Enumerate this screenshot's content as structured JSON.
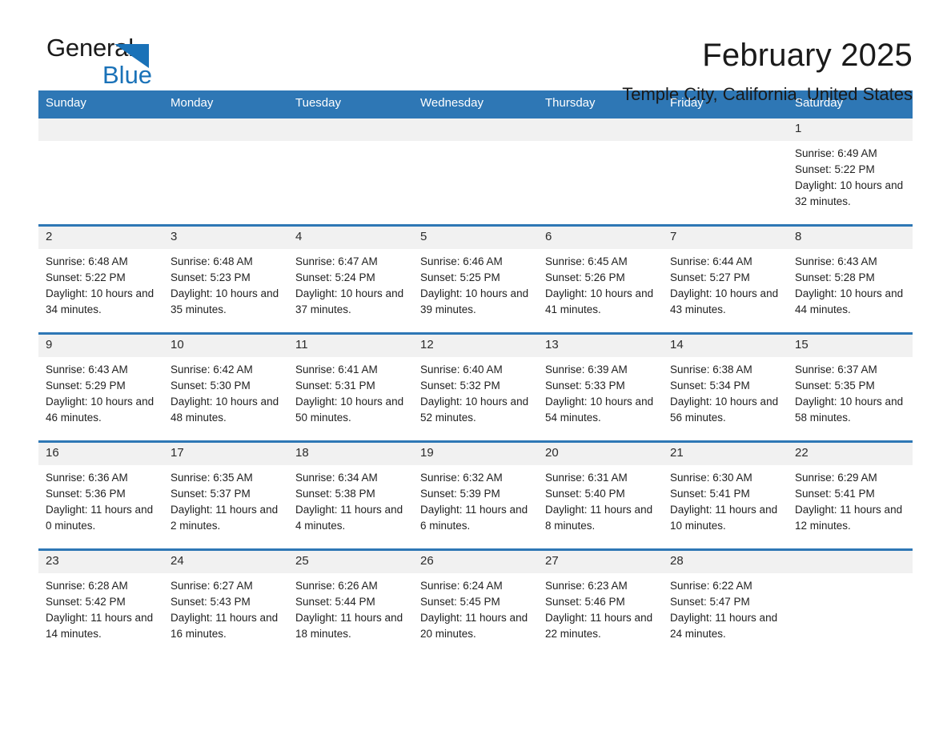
{
  "brand": {
    "name_part1": "General",
    "name_part2": "Blue",
    "accent_color": "#1a72b8"
  },
  "header": {
    "month_title": "February 2025",
    "location": "Temple City, California, United States"
  },
  "theme": {
    "header_blue": "#2e77b5",
    "daynum_bg": "#f1f1f1",
    "text": "#1f1f1f"
  },
  "weekday_headers": [
    "Sunday",
    "Monday",
    "Tuesday",
    "Wednesday",
    "Thursday",
    "Friday",
    "Saturday"
  ],
  "labels": {
    "sunrise_prefix": "Sunrise:",
    "sunset_prefix": "Sunset:",
    "daylight_prefix": "Daylight:"
  },
  "weeks": [
    [
      {
        "blank": true
      },
      {
        "blank": true
      },
      {
        "blank": true
      },
      {
        "blank": true
      },
      {
        "blank": true
      },
      {
        "blank": true
      },
      {
        "day": "1",
        "sunrise": "Sunrise: 6:49 AM",
        "sunset": "Sunset: 5:22 PM",
        "daylight": "Daylight: 10 hours and 32 minutes."
      }
    ],
    [
      {
        "day": "2",
        "sunrise": "Sunrise: 6:48 AM",
        "sunset": "Sunset: 5:22 PM",
        "daylight": "Daylight: 10 hours and 34 minutes."
      },
      {
        "day": "3",
        "sunrise": "Sunrise: 6:48 AM",
        "sunset": "Sunset: 5:23 PM",
        "daylight": "Daylight: 10 hours and 35 minutes."
      },
      {
        "day": "4",
        "sunrise": "Sunrise: 6:47 AM",
        "sunset": "Sunset: 5:24 PM",
        "daylight": "Daylight: 10 hours and 37 minutes."
      },
      {
        "day": "5",
        "sunrise": "Sunrise: 6:46 AM",
        "sunset": "Sunset: 5:25 PM",
        "daylight": "Daylight: 10 hours and 39 minutes."
      },
      {
        "day": "6",
        "sunrise": "Sunrise: 6:45 AM",
        "sunset": "Sunset: 5:26 PM",
        "daylight": "Daylight: 10 hours and 41 minutes."
      },
      {
        "day": "7",
        "sunrise": "Sunrise: 6:44 AM",
        "sunset": "Sunset: 5:27 PM",
        "daylight": "Daylight: 10 hours and 43 minutes."
      },
      {
        "day": "8",
        "sunrise": "Sunrise: 6:43 AM",
        "sunset": "Sunset: 5:28 PM",
        "daylight": "Daylight: 10 hours and 44 minutes."
      }
    ],
    [
      {
        "day": "9",
        "sunrise": "Sunrise: 6:43 AM",
        "sunset": "Sunset: 5:29 PM",
        "daylight": "Daylight: 10 hours and 46 minutes."
      },
      {
        "day": "10",
        "sunrise": "Sunrise: 6:42 AM",
        "sunset": "Sunset: 5:30 PM",
        "daylight": "Daylight: 10 hours and 48 minutes."
      },
      {
        "day": "11",
        "sunrise": "Sunrise: 6:41 AM",
        "sunset": "Sunset: 5:31 PM",
        "daylight": "Daylight: 10 hours and 50 minutes."
      },
      {
        "day": "12",
        "sunrise": "Sunrise: 6:40 AM",
        "sunset": "Sunset: 5:32 PM",
        "daylight": "Daylight: 10 hours and 52 minutes."
      },
      {
        "day": "13",
        "sunrise": "Sunrise: 6:39 AM",
        "sunset": "Sunset: 5:33 PM",
        "daylight": "Daylight: 10 hours and 54 minutes."
      },
      {
        "day": "14",
        "sunrise": "Sunrise: 6:38 AM",
        "sunset": "Sunset: 5:34 PM",
        "daylight": "Daylight: 10 hours and 56 minutes."
      },
      {
        "day": "15",
        "sunrise": "Sunrise: 6:37 AM",
        "sunset": "Sunset: 5:35 PM",
        "daylight": "Daylight: 10 hours and 58 minutes."
      }
    ],
    [
      {
        "day": "16",
        "sunrise": "Sunrise: 6:36 AM",
        "sunset": "Sunset: 5:36 PM",
        "daylight": "Daylight: 11 hours and 0 minutes."
      },
      {
        "day": "17",
        "sunrise": "Sunrise: 6:35 AM",
        "sunset": "Sunset: 5:37 PM",
        "daylight": "Daylight: 11 hours and 2 minutes."
      },
      {
        "day": "18",
        "sunrise": "Sunrise: 6:34 AM",
        "sunset": "Sunset: 5:38 PM",
        "daylight": "Daylight: 11 hours and 4 minutes."
      },
      {
        "day": "19",
        "sunrise": "Sunrise: 6:32 AM",
        "sunset": "Sunset: 5:39 PM",
        "daylight": "Daylight: 11 hours and 6 minutes."
      },
      {
        "day": "20",
        "sunrise": "Sunrise: 6:31 AM",
        "sunset": "Sunset: 5:40 PM",
        "daylight": "Daylight: 11 hours and 8 minutes."
      },
      {
        "day": "21",
        "sunrise": "Sunrise: 6:30 AM",
        "sunset": "Sunset: 5:41 PM",
        "daylight": "Daylight: 11 hours and 10 minutes."
      },
      {
        "day": "22",
        "sunrise": "Sunrise: 6:29 AM",
        "sunset": "Sunset: 5:41 PM",
        "daylight": "Daylight: 11 hours and 12 minutes."
      }
    ],
    [
      {
        "day": "23",
        "sunrise": "Sunrise: 6:28 AM",
        "sunset": "Sunset: 5:42 PM",
        "daylight": "Daylight: 11 hours and 14 minutes."
      },
      {
        "day": "24",
        "sunrise": "Sunrise: 6:27 AM",
        "sunset": "Sunset: 5:43 PM",
        "daylight": "Daylight: 11 hours and 16 minutes."
      },
      {
        "day": "25",
        "sunrise": "Sunrise: 6:26 AM",
        "sunset": "Sunset: 5:44 PM",
        "daylight": "Daylight: 11 hours and 18 minutes."
      },
      {
        "day": "26",
        "sunrise": "Sunrise: 6:24 AM",
        "sunset": "Sunset: 5:45 PM",
        "daylight": "Daylight: 11 hours and 20 minutes."
      },
      {
        "day": "27",
        "sunrise": "Sunrise: 6:23 AM",
        "sunset": "Sunset: 5:46 PM",
        "daylight": "Daylight: 11 hours and 22 minutes."
      },
      {
        "day": "28",
        "sunrise": "Sunrise: 6:22 AM",
        "sunset": "Sunset: 5:47 PM",
        "daylight": "Daylight: 11 hours and 24 minutes."
      },
      {
        "blank": true
      }
    ]
  ]
}
